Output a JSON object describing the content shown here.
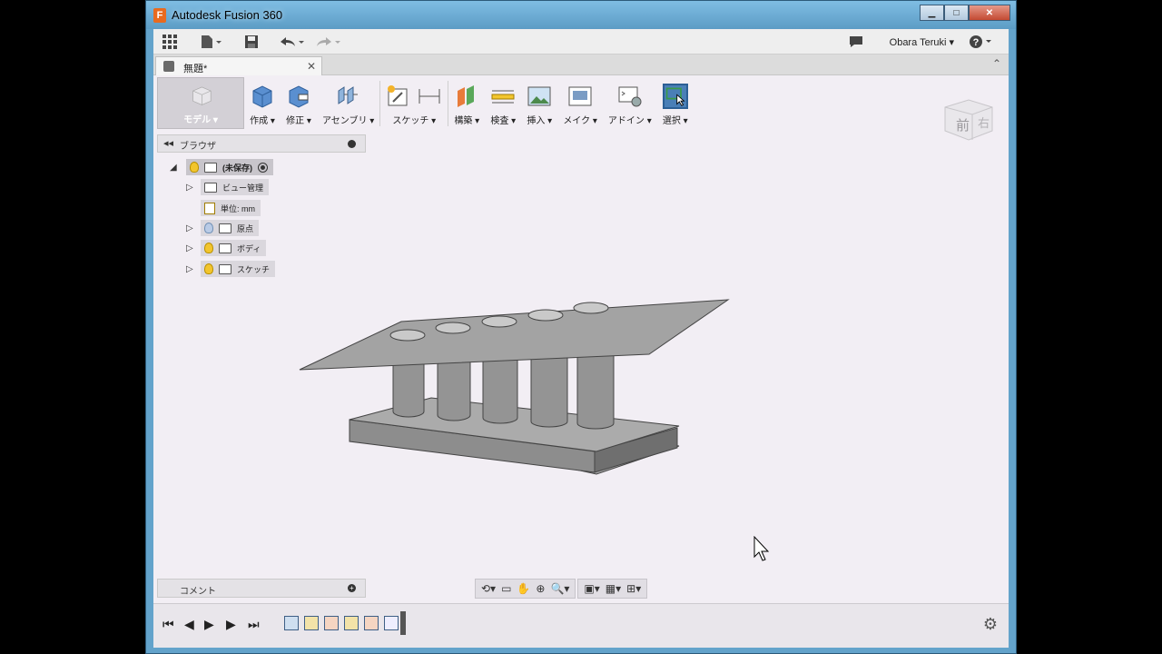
{
  "window": {
    "title": "Autodesk Fusion 360",
    "minimize": "▁",
    "maximize": "□",
    "close": "✕"
  },
  "qat": {
    "user": "Obara Teruki ▾",
    "help": "?"
  },
  "document_tab": {
    "name": "無題*",
    "close": "✕"
  },
  "ribbon": {
    "workspace": "モデル ▾",
    "groups": [
      {
        "label": "作成 ▾",
        "icon": "box-icon"
      },
      {
        "label": "修正 ▾",
        "icon": "modify-icon"
      },
      {
        "label": "アセンブリ ▾",
        "icon": "assembly-icon"
      },
      {
        "label": "スケッチ ▾",
        "icon": "sketch-icon"
      },
      {
        "label": "構築 ▾",
        "icon": "construct-icon"
      },
      {
        "label": "検査 ▾",
        "icon": "inspect-icon"
      },
      {
        "label": "挿入 ▾",
        "icon": "insert-image-icon"
      },
      {
        "label": "メイク ▾",
        "icon": "make-icon"
      },
      {
        "label": "アドイン ▾",
        "icon": "addin-icon"
      },
      {
        "label": "選択 ▾",
        "icon": "select-icon"
      }
    ]
  },
  "viewcube": {
    "front": "前",
    "right": "右"
  },
  "browser": {
    "title": "ブラウザ",
    "root": "(未保存)",
    "items": [
      {
        "label": "ビュー管理",
        "bulb": "none",
        "expandable": true
      },
      {
        "label": "単位: mm",
        "bulb": "none",
        "expandable": false
      },
      {
        "label": "原点",
        "bulb": "off",
        "expandable": true
      },
      {
        "label": "ボディ",
        "bulb": "on",
        "expandable": true
      },
      {
        "label": "スケッチ",
        "bulb": "on",
        "expandable": true
      }
    ]
  },
  "comments": {
    "title": "コメント"
  },
  "colors": {
    "titlebar": "#63a3cb",
    "canvas": "#f2eef4",
    "model_face": "#a4a4a4",
    "select_blue": "#4a7fb7"
  }
}
